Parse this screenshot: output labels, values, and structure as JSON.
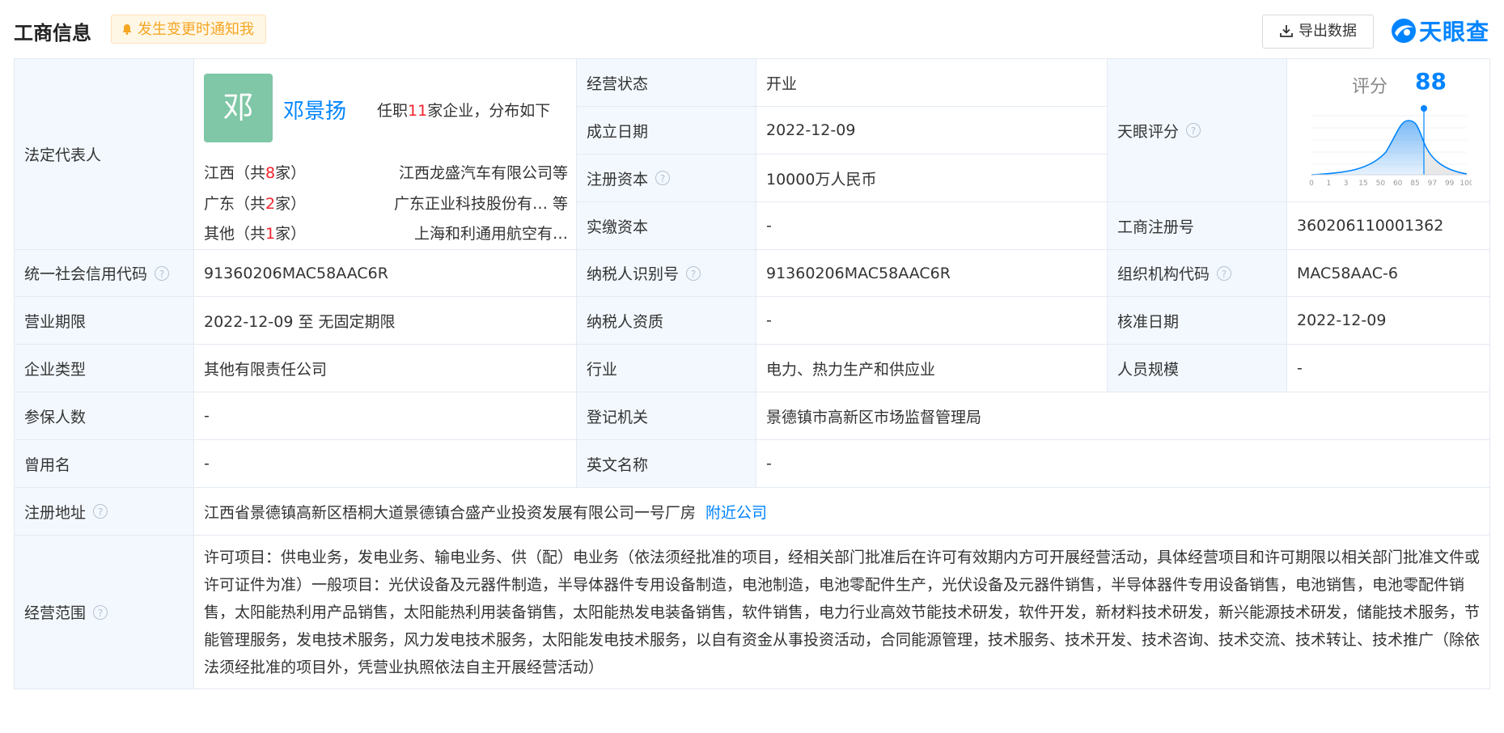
{
  "header": {
    "title": "工商信息",
    "notify_label": "发生变更时通知我",
    "export_label": "导出数据",
    "logo_text": "天眼查",
    "accent_color": "#0084ff"
  },
  "legal_rep": {
    "label": "法定代表人",
    "avatar_char": "邓",
    "name": "邓景扬",
    "info_prefix": "任职",
    "info_count": "11",
    "info_suffix": "家企业，分布如下",
    "regions": [
      {
        "prefix": "江西（共",
        "count": "8",
        "suffix": "家）",
        "company": "江西龙盛汽车有限公司等"
      },
      {
        "prefix": "广东（共",
        "count": "2",
        "suffix": "家）",
        "company": "广东正业科技股份有…  等"
      },
      {
        "prefix": "其他（共",
        "count": "1",
        "suffix": "家）",
        "company": "上海和利通用航空有…"
      }
    ]
  },
  "status": {
    "label": "经营状态",
    "value": "开业"
  },
  "established": {
    "label": "成立日期",
    "value": "2022-12-09"
  },
  "reg_capital": {
    "label": "注册资本",
    "value": "10000万人民币"
  },
  "paid_capital": {
    "label": "实缴资本",
    "value": "-"
  },
  "tianyan_score": {
    "label": "天眼评分",
    "score_label": "评分",
    "score": 88,
    "axis_ticks": [
      "0",
      "1",
      "3",
      "15",
      "50",
      "60",
      "85",
      "97",
      "99",
      "100"
    ]
  },
  "reg_number": {
    "label": "工商注册号",
    "value": "360206110001362"
  },
  "credit_code": {
    "label": "统一社会信用代码",
    "value": "91360206MAC58AAC6R"
  },
  "taxpayer_id": {
    "label": "纳税人识别号",
    "value": "91360206MAC58AAC6R"
  },
  "org_code": {
    "label": "组织机构代码",
    "value": "MAC58AAC-6"
  },
  "biz_term": {
    "label": "营业期限",
    "value": "2022-12-09 至 无固定期限"
  },
  "taxpayer_qual": {
    "label": "纳税人资质",
    "value": "-"
  },
  "approval_date": {
    "label": "核准日期",
    "value": "2022-12-09"
  },
  "company_type": {
    "label": "企业类型",
    "value": "其他有限责任公司"
  },
  "industry": {
    "label": "行业",
    "value": "电力、热力生产和供应业"
  },
  "staff_size": {
    "label": "人员规模",
    "value": "-"
  },
  "insured": {
    "label": "参保人数",
    "value": "-"
  },
  "reg_authority": {
    "label": "登记机关",
    "value": "景德镇市高新区市场监督管理局"
  },
  "former_name": {
    "label": "曾用名",
    "value": "-"
  },
  "english_name": {
    "label": "英文名称",
    "value": "-"
  },
  "address": {
    "label": "注册地址",
    "value": "江西省景德镇高新区梧桐大道景德镇合盛产业投资发展有限公司一号厂房",
    "link": "附近公司"
  },
  "scope": {
    "label": "经营范围",
    "value": "许可项目：供电业务，发电业务、输电业务、供（配）电业务（依法须经批准的项目，经相关部门批准后在许可有效期内方可开展经营活动，具体经营项目和许可期限以相关部门批准文件或许可证件为准）一般项目：光伏设备及元器件制造，半导体器件专用设备制造，电池制造，电池零配件生产，光伏设备及元器件销售，半导体器件专用设备销售，电池销售，电池零配件销售，太阳能热利用产品销售，太阳能热利用装备销售，太阳能热发电装备销售，软件销售，电力行业高效节能技术研发，软件开发，新材料技术研发，新兴能源技术研发，储能技术服务，节能管理服务，发电技术服务，风力发电技术服务，太阳能发电技术服务，以自有资金从事投资活动，合同能源管理，技术服务、技术开发、技术咨询、技术交流、技术转让、技术推广（除依法须经批准的项目外，凭营业执照依法自主开展经营活动）"
  }
}
